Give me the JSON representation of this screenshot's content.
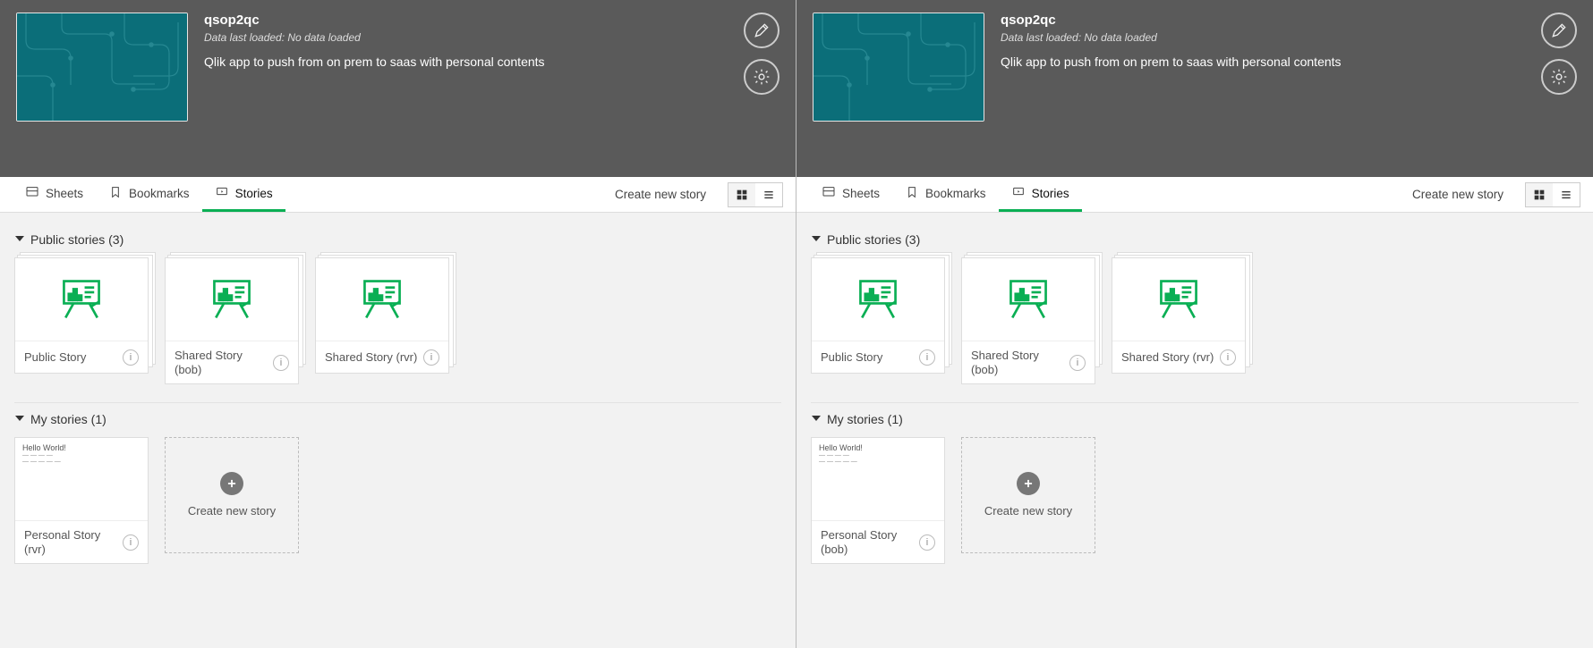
{
  "panes": [
    {
      "app_title": "qsop2qc",
      "app_sub": "Data last loaded: No data loaded",
      "app_desc": "Qlik app to push from on prem to saas with personal contents",
      "tabs": {
        "sheets": "Sheets",
        "bookmarks": "Bookmarks",
        "stories": "Stories"
      },
      "create_link": "Create new story",
      "public": {
        "head": "Public stories (3)",
        "items": [
          {
            "title": "Public Story"
          },
          {
            "title": "Shared Story (bob)"
          },
          {
            "title": "Shared Story (rvr)"
          }
        ]
      },
      "mine": {
        "head": "My stories (1)",
        "item_title": "Personal Story (rvr)",
        "item_preview_title": "Hello World!",
        "create_label": "Create new story"
      }
    },
    {
      "app_title": "qsop2qc",
      "app_sub": "Data last loaded: No data loaded",
      "app_desc": "Qlik app to push from on prem to saas with personal contents",
      "tabs": {
        "sheets": "Sheets",
        "bookmarks": "Bookmarks",
        "stories": "Stories"
      },
      "create_link": "Create new story",
      "public": {
        "head": "Public stories (3)",
        "items": [
          {
            "title": "Public Story"
          },
          {
            "title": "Shared Story (bob)"
          },
          {
            "title": "Shared Story (rvr)"
          }
        ]
      },
      "mine": {
        "head": "My stories (1)",
        "item_title": "Personal Story (bob)",
        "item_preview_title": "Hello World!",
        "create_label": "Create new story"
      }
    }
  ]
}
